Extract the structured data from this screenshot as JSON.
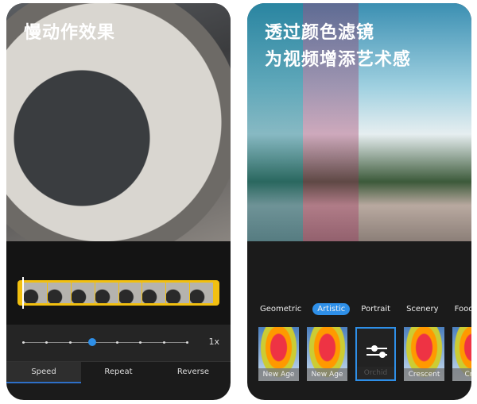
{
  "left": {
    "title": "慢动作效果",
    "speed_value": "1x",
    "speed_level_index": 3,
    "speed_steps": 8,
    "tabs": [
      "Speed",
      "Repeat",
      "Reverse"
    ],
    "active_tab": "Speed"
  },
  "right": {
    "title_line1": "透过颜色滤镜",
    "title_line2": "为视频增添艺术感",
    "categories": [
      "Geometric",
      "Artistic",
      "Portrait",
      "Scenery",
      "Food"
    ],
    "active_category": "Artistic",
    "filters": [
      "New Age",
      "New Age",
      "Orchid",
      "Crescent",
      "Cres"
    ],
    "selected_filter": "Orchid",
    "accent": "#2e8fe8"
  }
}
